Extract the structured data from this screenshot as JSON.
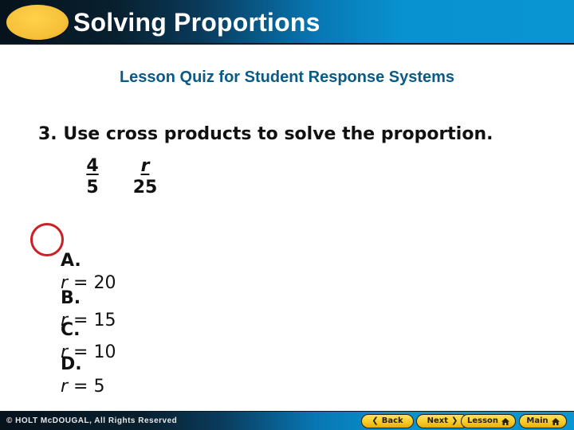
{
  "header": {
    "title": "Solving Proportions",
    "accent_oval_color": "#f7c13a"
  },
  "subtitle": "Lesson Quiz for Student Response Systems",
  "question": {
    "text": "3. Use cross products to solve the proportion.",
    "proportion": {
      "left": {
        "numerator": "4",
        "denominator": "5"
      },
      "right": {
        "numerator": "r",
        "denominator": "25"
      }
    }
  },
  "options": [
    {
      "letter": "A.",
      "variable": "r",
      "relation": " = 20",
      "selected": true
    },
    {
      "letter": "B.",
      "variable": "r",
      "relation": " = 15",
      "selected": false
    },
    {
      "letter": "C.",
      "variable": "r",
      "relation": " = 10",
      "selected": false
    },
    {
      "letter": "D.",
      "variable": "r",
      "relation": " = 5",
      "selected": false
    }
  ],
  "answer_marker_color": "#cc1f26",
  "footer": {
    "copyright": "© HOLT McDOUGAL, All Rights Reserved",
    "buttons": {
      "back": {
        "label": "Back",
        "icon": "chevron-left-icon",
        "glyph": "❮"
      },
      "next": {
        "label": "Next",
        "icon": "chevron-right-icon",
        "glyph": "❯"
      },
      "lesson": {
        "label": "Lesson",
        "icon": "home-icon"
      },
      "main": {
        "label": "Main",
        "icon": "home-icon"
      }
    }
  }
}
